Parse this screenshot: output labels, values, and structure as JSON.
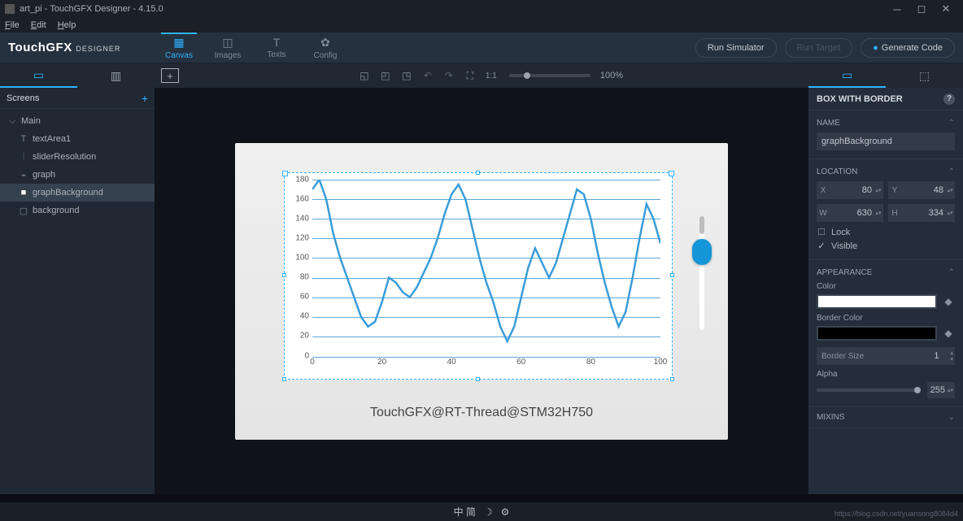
{
  "titlebar": {
    "project": "art_pi",
    "app": "TouchGFX Designer - 4.15.0"
  },
  "menu": {
    "file": "File",
    "edit": "Edit",
    "help": "Help"
  },
  "logo": {
    "main": "TouchGFX",
    "sub": "DESIGNER"
  },
  "modes": {
    "canvas": "Canvas",
    "images": "Images",
    "texts": "Texts",
    "config": "Config"
  },
  "topbuttons": {
    "run": "Run Simulator",
    "target": "Run Target",
    "gen": "Generate Code"
  },
  "zoom": "100%",
  "sidebar": {
    "title": "Screens",
    "screen": "Main",
    "items": [
      {
        "icon": "T",
        "label": "textArea1"
      },
      {
        "icon": "⫶",
        "label": "sliderResolution"
      },
      {
        "icon": "⌁",
        "label": "graph"
      },
      {
        "icon": "■",
        "label": "graphBackground"
      },
      {
        "icon": "▢",
        "label": "background"
      }
    ]
  },
  "device": {
    "caption": "TouchGFX@RT-Thread@STM32H750"
  },
  "chart_data": {
    "type": "line",
    "xlabel": "",
    "ylabel": "",
    "xlim": [
      0,
      100
    ],
    "ylim": [
      0,
      180
    ],
    "xticks": [
      0,
      20,
      40,
      60,
      80,
      100
    ],
    "yticks": [
      0,
      20,
      40,
      60,
      80,
      100,
      120,
      140,
      160,
      180
    ],
    "x": [
      0,
      2,
      4,
      6,
      8,
      10,
      12,
      14,
      16,
      18,
      20,
      22,
      24,
      26,
      28,
      30,
      32,
      34,
      36,
      38,
      40,
      42,
      44,
      46,
      48,
      50,
      52,
      54,
      56,
      58,
      60,
      62,
      64,
      66,
      68,
      70,
      72,
      74,
      76,
      78,
      80,
      82,
      84,
      86,
      88,
      90,
      92,
      94,
      96,
      98,
      100
    ],
    "values": [
      170,
      180,
      160,
      125,
      100,
      80,
      60,
      40,
      30,
      35,
      55,
      80,
      75,
      65,
      60,
      70,
      85,
      100,
      120,
      145,
      165,
      175,
      160,
      130,
      100,
      75,
      55,
      30,
      15,
      30,
      60,
      90,
      110,
      95,
      80,
      95,
      120,
      145,
      170,
      165,
      140,
      105,
      75,
      50,
      30,
      45,
      80,
      120,
      155,
      140,
      115
    ]
  },
  "props": {
    "header": "BOX WITH BORDER",
    "name": {
      "title": "NAME",
      "value": "graphBackground"
    },
    "location": {
      "title": "LOCATION",
      "X": "80",
      "Y": "48",
      "W": "630",
      "H": "334",
      "lock": "Lock",
      "visible": "Visible"
    },
    "appearance": {
      "title": "APPEARANCE",
      "color": "Color",
      "border": "Border Color",
      "bsize": "Border Size",
      "bsizeval": "1",
      "alpha": "Alpha",
      "alphaval": "255"
    },
    "mixins": "MIXINS"
  },
  "footer": {
    "ime": "中 简",
    "watermark": "https://blog.csdn.net/yuansong8084d4"
  }
}
